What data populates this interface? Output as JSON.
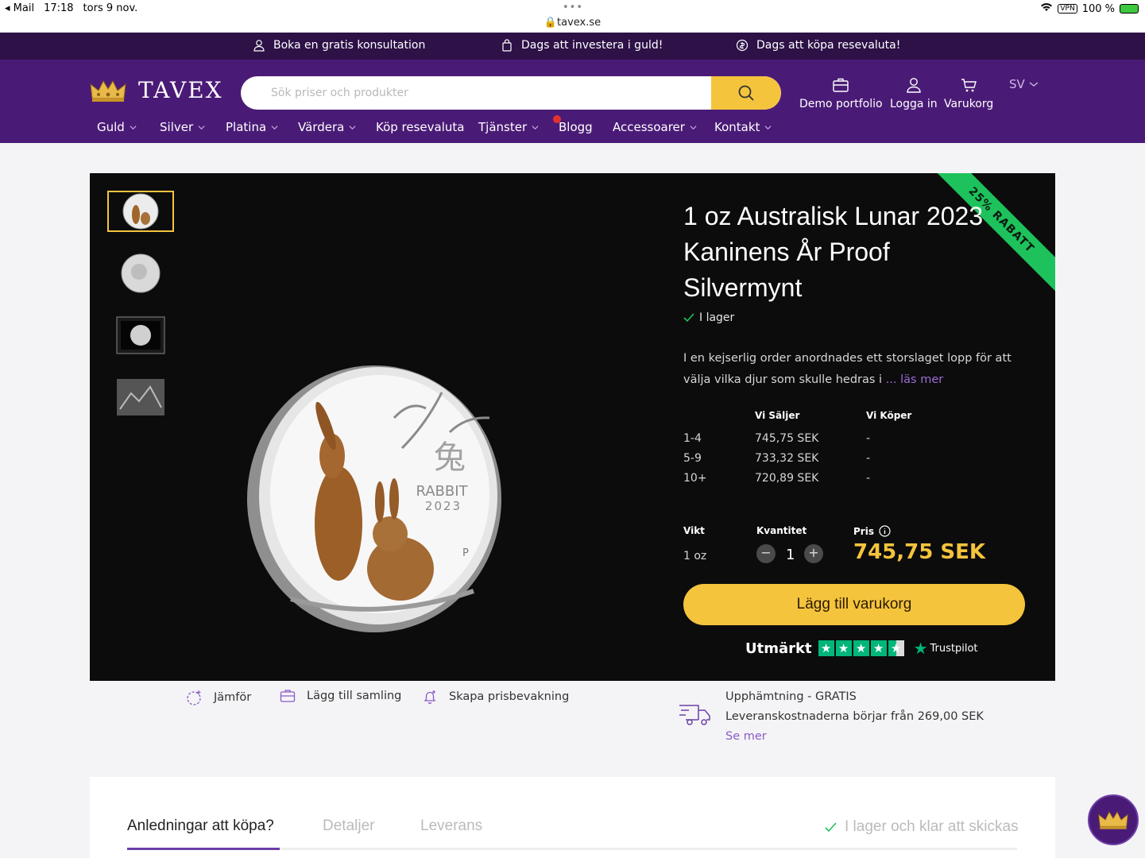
{
  "statusbar": {
    "back_app": "◂ Mail",
    "time": "17:18",
    "date": "tors 9 nov.",
    "url": "tavex.se",
    "vpn": "VPN",
    "battery": "100 %"
  },
  "promo": {
    "consult": "Boka en gratis konsultation",
    "gold": "Dags att investera i guld!",
    "currency": "Dags att köpa resevaluta!"
  },
  "header": {
    "logo": "TAVEX",
    "search_placeholder": "Sök priser och produkter",
    "actions": {
      "portfolio": "Demo portfolio",
      "login": "Logga in",
      "cart": "Varukorg"
    },
    "lang": "SV"
  },
  "nav": [
    "Guld",
    "Silver",
    "Platina",
    "Värdera",
    "Köp resevaluta",
    "Tjänster",
    "Blogg",
    "Accessoarer",
    "Kontakt"
  ],
  "product": {
    "ribbon": "25% RABATT",
    "title": "1 oz Australisk Lunar 2023 Kaninens År Proof Silvermynt",
    "stock": "I lager",
    "desc": "I en kejserlig order anordnades ett storslaget lopp för att välja vilka djur som skulle hedras i",
    "read_more": "... läs mer",
    "price_head": {
      "sell": "Vi Säljer",
      "buy": "Vi Köper"
    },
    "tiers": [
      {
        "qty": "1-4",
        "sell": "745,75 SEK",
        "buy": "-"
      },
      {
        "qty": "5-9",
        "sell": "733,32 SEK",
        "buy": "-"
      },
      {
        "qty": "10+",
        "sell": "720,89 SEK",
        "buy": "-"
      }
    ],
    "weight_label": "Vikt",
    "weight": "1 oz",
    "qty_label": "Kvantitet",
    "qty": "1",
    "price_label": "Pris",
    "price": "745,75 SEK",
    "add_to_cart": "Lägg till varukorg",
    "trustpilot_rating": "Utmärkt",
    "trustpilot_brand": "Trustpilot",
    "coin_text": {
      "glyph": "兔",
      "name": "RABBIT",
      "year": "2023",
      "mint": "P"
    }
  },
  "actions": {
    "compare": "Jämför",
    "collection": "Lägg till samling",
    "alert": "Skapa prisbevakning"
  },
  "shipping": {
    "pickup": "Upphämtning - GRATIS",
    "cost": "Leveranskostnaderna börjar från 269,00 SEK",
    "more": "Se mer"
  },
  "tabs": {
    "reasons": "Anledningar att köpa?",
    "details": "Detaljer",
    "delivery": "Leverans",
    "stock": "I lager och klar att skickas"
  },
  "colors": {
    "purple": "#4a1b76",
    "dark_purple": "#2d1147",
    "gold": "#f5c43d",
    "green": "#1ec25c"
  }
}
